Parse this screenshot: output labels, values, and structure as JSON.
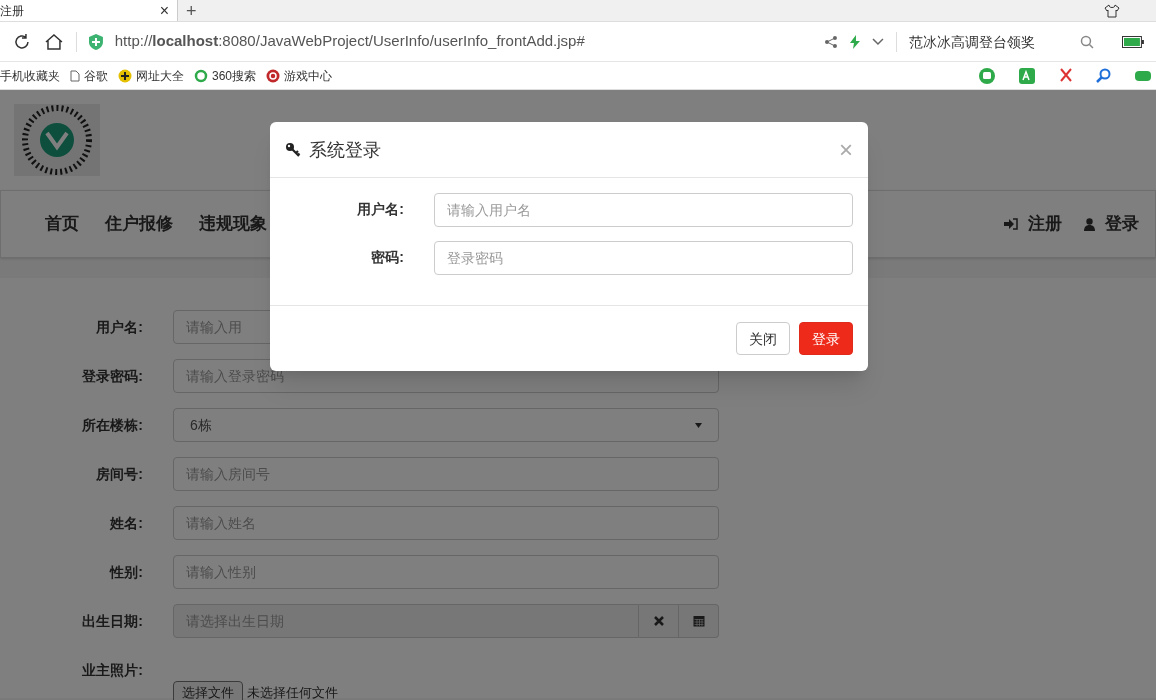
{
  "browser": {
    "tab_title": "注册",
    "tab_close": "×",
    "new_tab": "+",
    "url": "http://**localhost**:8080/JavaWebProject/UserInfo/userInfo_frontAdd.jsp#",
    "search_text": "范冰冰高调登台领奖",
    "bookmarks": [
      {
        "label": "手机收藏夹",
        "kind": "none"
      },
      {
        "label": "谷歌",
        "kind": "page"
      },
      {
        "label": "网址大全",
        "kind": "plus"
      },
      {
        "label": "360搜索",
        "kind": "ring"
      },
      {
        "label": "游戏中心",
        "kind": "game"
      }
    ]
  },
  "page": {
    "nav": [
      "首页",
      "住户报修",
      "违规现象"
    ],
    "nav_right": [
      {
        "label": "注册",
        "kind": "signin"
      },
      {
        "label": "登录",
        "kind": "user"
      }
    ],
    "form": [
      {
        "label": "用户名:",
        "kind": "text",
        "placeholder": "请输入用"
      },
      {
        "label": "登录密码:",
        "kind": "text",
        "placeholder": "请输入登录密码"
      },
      {
        "label": "所在楼栋:",
        "kind": "select",
        "value": "6栋"
      },
      {
        "label": "房间号:",
        "kind": "text",
        "placeholder": "请输入房间号"
      },
      {
        "label": "姓名:",
        "kind": "text",
        "placeholder": "请输入姓名"
      },
      {
        "label": "性别:",
        "kind": "text",
        "placeholder": "请输入性别"
      },
      {
        "label": "出生日期:",
        "kind": "date",
        "placeholder": "请选择出生日期"
      },
      {
        "label": "业主照片:",
        "kind": "file",
        "button": "选择文件",
        "value": "未选择任何文件"
      }
    ]
  },
  "modal": {
    "title": "系统登录",
    "close": "×",
    "fields": [
      {
        "label": "用户名:",
        "placeholder": "请输入用户名"
      },
      {
        "label": "密码:",
        "placeholder": "登录密码"
      }
    ],
    "buttons": [
      {
        "label": "关闭",
        "kind": "default"
      },
      {
        "label": "登录",
        "kind": "primary"
      }
    ]
  }
}
